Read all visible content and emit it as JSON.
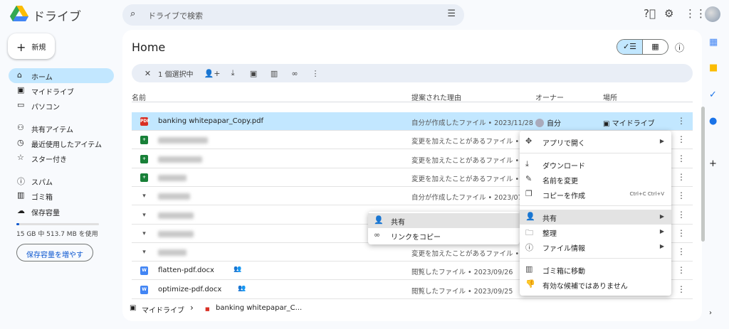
{
  "app": {
    "title": "ドライブ"
  },
  "search": {
    "placeholder": "ドライブで検索"
  },
  "sidebar": {
    "new_label": "新規",
    "items": [
      {
        "icon": "home-icon",
        "glyph": "⌂",
        "label": "ホーム"
      },
      {
        "icon": "my-drive-icon",
        "glyph": "▣",
        "label": "マイドライブ"
      },
      {
        "icon": "computer-icon",
        "glyph": "▭",
        "label": "パソコン"
      },
      {
        "icon": "shared-icon",
        "glyph": "👥",
        "label": "共有アイテム"
      },
      {
        "icon": "clock-icon",
        "glyph": "◷",
        "label": "最近使用したアイテム"
      },
      {
        "icon": "star-icon",
        "glyph": "☆",
        "label": "スター付き"
      },
      {
        "icon": "spam-icon",
        "glyph": "ⓘ",
        "label": "スパム"
      },
      {
        "icon": "trash-icon",
        "glyph": "🗑",
        "label": "ゴミ箱"
      },
      {
        "icon": "cloud-icon",
        "glyph": "☁",
        "label": "保存容量"
      }
    ],
    "storage_text": "15 GB 中 513.7 MB を使用",
    "storage_fraction": 0.034,
    "storage_button": "保存容量を増やす"
  },
  "main": {
    "title": "Home",
    "selection": "1 個選択中",
    "columns": {
      "name": "名前",
      "reason": "提案された理由",
      "owner": "オーナー",
      "location": "場所"
    },
    "rows": [
      {
        "type": "pdf",
        "name": "banking whitepapar_Copy.pdf",
        "reason": "自分が作成したファイル • 2023/11/28",
        "owner": "自分",
        "location": "マイドライブ",
        "selected": true
      },
      {
        "type": "sheet",
        "name": "",
        "reason": "変更を加えたことがあるファイル • 2"
      },
      {
        "type": "sheet",
        "name": "",
        "reason": "変更を加えたことがあるファイル • 2"
      },
      {
        "type": "sheet",
        "name": "",
        "reason": "変更を加えたことがあるファイル • 2"
      },
      {
        "type": "other",
        "name": "",
        "reason": "自分が作成したファイル • 2023/07/1"
      },
      {
        "type": "other",
        "name": "",
        "reason": ""
      },
      {
        "type": "other",
        "name": "",
        "reason": ""
      },
      {
        "type": "other",
        "name": "",
        "reason": "変更を加えたことがあるファイル • 2"
      },
      {
        "type": "doc",
        "name": "flatten-pdf.docx",
        "reason": "閲覧したファイル • 2023/09/26",
        "shared": true
      },
      {
        "type": "doc",
        "name": "optimize-pdf.docx",
        "reason": "閲覧したファイル • 2023/09/25",
        "shared": true
      }
    ]
  },
  "context_menu": {
    "items": [
      {
        "label": "アプリで開く",
        "submenu": true
      },
      {
        "label": "ダウンロード"
      },
      {
        "label": "名前を変更"
      },
      {
        "label": "コピーを作成",
        "shortcut": "Ctrl+C Ctrl+V"
      },
      {
        "label": "共有",
        "submenu": true
      },
      {
        "label": "整理",
        "submenu": true
      },
      {
        "label": "ファイル情報",
        "submenu": true
      },
      {
        "label": "ゴミ箱に移動"
      },
      {
        "label": "有効な候補ではありません"
      }
    ]
  },
  "share_submenu": {
    "items": [
      {
        "label": "共有"
      },
      {
        "label": "リンクをコピー"
      }
    ]
  },
  "breadcrumb": {
    "root": "マイドライブ",
    "file": "banking whitepapar_C..."
  }
}
